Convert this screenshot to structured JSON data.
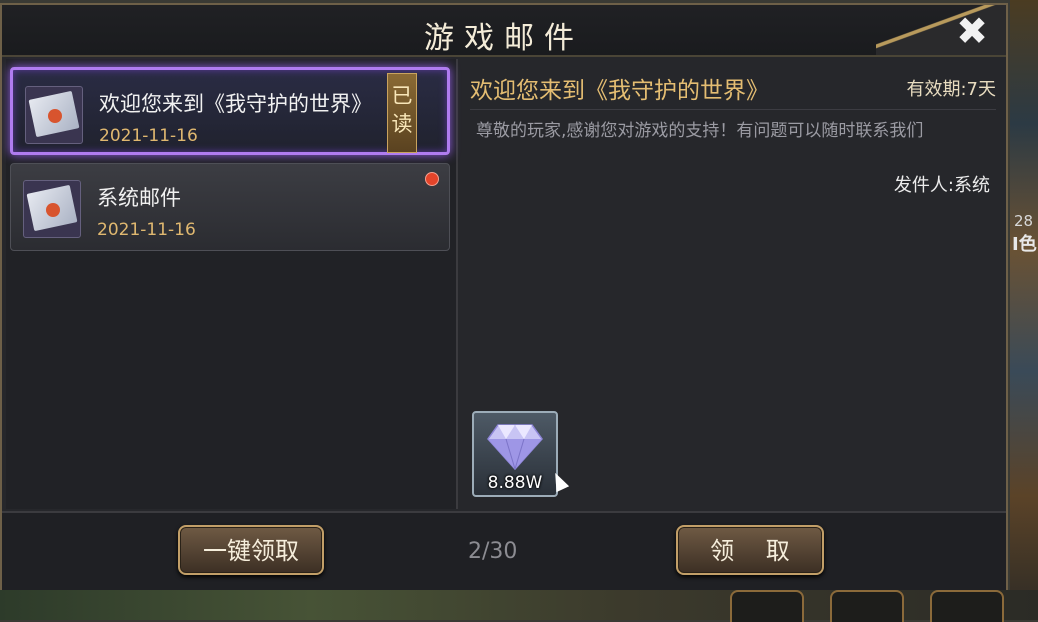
{
  "header": {
    "title": "游戏邮件",
    "close_icon": "close-icon"
  },
  "mail_list": [
    {
      "subject": "欢迎您来到《我守护的世界》",
      "date": "2021-11-16",
      "badge": "已读",
      "selected": true
    },
    {
      "subject": "系统邮件",
      "date": "2021-11-16",
      "unread": true
    }
  ],
  "detail": {
    "title": "欢迎您来到《我守护的世界》",
    "validity": "有效期:7天",
    "body": "尊敬的玩家,感谢您对游戏的支持！有问题可以随时联系我们",
    "sender": "发件人:系统",
    "attachment": {
      "icon": "diamond-icon",
      "count": "8.88W"
    }
  },
  "footer": {
    "claim_all_label": "一键领取",
    "page_count": "2/30",
    "claim_label": "领 取"
  },
  "background": {
    "side_number": "28",
    "side_text": "I色"
  },
  "colors": {
    "accent_gold": "#e4bd72",
    "selected_purple": "#b07cf0",
    "unread_red": "#e4442a"
  }
}
